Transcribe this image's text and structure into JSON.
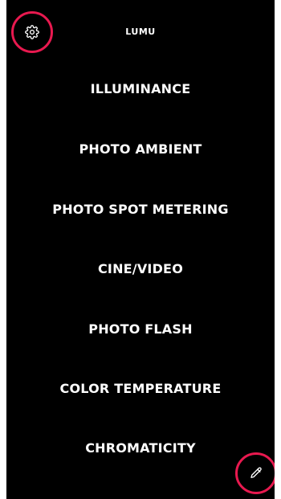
{
  "app": {
    "title": "LUMU"
  },
  "menu": {
    "items": [
      {
        "label": "ILLUMINANCE"
      },
      {
        "label": "PHOTO AMBIENT"
      },
      {
        "label": "PHOTO SPOT METERING"
      },
      {
        "label": "CINE/VIDEO"
      },
      {
        "label": "PHOTO FLASH"
      },
      {
        "label": "COLOR TEMPERATURE"
      },
      {
        "label": "CHROMATICITY"
      }
    ]
  },
  "icons": {
    "settings": "gear-icon",
    "edit": "pencil-icon"
  },
  "colors": {
    "background": "#000000",
    "text": "#ffffff",
    "highlight_ring": "#e8194f"
  }
}
